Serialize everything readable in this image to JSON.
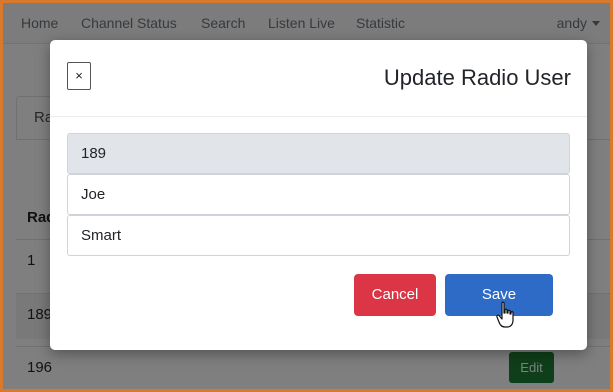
{
  "navbar": {
    "items": [
      "Home",
      "Channel Status",
      "Search",
      "Listen Live",
      "Statistic"
    ],
    "user": "andy"
  },
  "background": {
    "tab_label": "Radio Users",
    "column_header": "Radio",
    "rows": [
      {
        "id": "1"
      },
      {
        "id": "189"
      },
      {
        "id": "196"
      }
    ],
    "edit_label": "Edit"
  },
  "modal": {
    "close_label": "×",
    "title": "Update Radio User",
    "fields": {
      "radio_id": "189",
      "first_name": "Joe",
      "last_name": "Smart"
    },
    "cancel_label": "Cancel",
    "save_label": "Save"
  },
  "colors": {
    "frame": "#d77a2e",
    "cancel": "#dc3545",
    "save": "#2e6bc7",
    "edit": "#1e7e34"
  }
}
